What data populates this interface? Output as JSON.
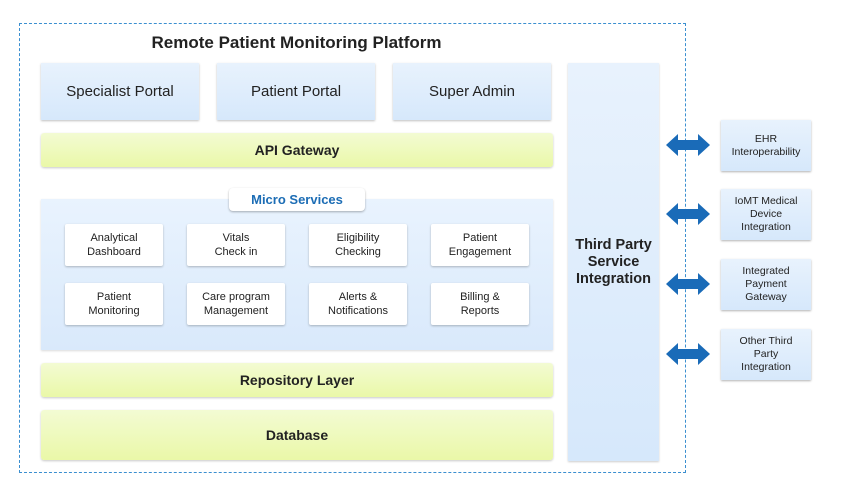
{
  "title": "Remote Patient Monitoring Platform",
  "portals": [
    "Specialist Portal",
    "Patient Portal",
    "Super Admin"
  ],
  "layers": {
    "api_gateway": "API Gateway",
    "repository": "Repository Layer",
    "database": "Database"
  },
  "micro_services": {
    "label": "Micro Services",
    "items": [
      "Analytical\nDashboard",
      "Vitals\nCheck in",
      "Eligibility\nChecking",
      "Patient\nEngagement",
      "Patient\nMonitoring",
      "Care program\nManagement",
      "Alerts &\nNotifications",
      "Billing &\nReports"
    ]
  },
  "third_party": {
    "label": "Third Party\nService\nIntegration",
    "integrations": [
      "EHR\nInteroperability",
      "IoMT Medical\nDevice\nIntegration",
      "Integrated\nPayment\nGateway",
      "Other Third\nParty\nIntegration"
    ]
  },
  "colors": {
    "accent_blue": "#1c6db5",
    "arrow_blue": "#1a6bb8",
    "frame_border": "#3b8fd0",
    "layer_green": "#eaf8a8",
    "panel_blue": "#d6e8fb"
  }
}
